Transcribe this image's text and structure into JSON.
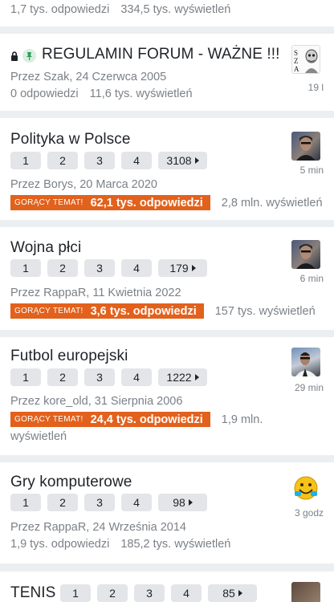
{
  "prev_topic": {
    "replies": "1,7 tys. odpowiedzi",
    "views": "334,5 tys. wyświetleń"
  },
  "topics": [
    {
      "title": "REGULAMIN FORUM - WAŻNE !!!",
      "meta": "Przez Szak, 24 Czerwca 2005",
      "replies": "0 odpowiedzi",
      "views": "11,6 tys. wyświetleń",
      "last": "19 l",
      "locked": true,
      "pinned": true
    },
    {
      "title": "Polityka w Polsce",
      "pages": [
        "1",
        "2",
        "3",
        "4",
        "3108"
      ],
      "meta": "Przez Borys, 20 Marca 2020",
      "hot_label": "GORĄCY TEMAT!",
      "replies": "62,1 tys. odpowiedzi",
      "views": "2,8 mln. wyświetleń",
      "last": "5 min"
    },
    {
      "title": "Wojna płci",
      "pages": [
        "1",
        "2",
        "3",
        "4",
        "179"
      ],
      "meta": "Przez RappaR, 11 Kwietnia 2022",
      "hot_label": "GORĄCY TEMAT!",
      "replies": "3,6 tys. odpowiedzi",
      "views": "157 tys. wyświetleń",
      "last": "6 min"
    },
    {
      "title": "Futbol europejski",
      "pages": [
        "1",
        "2",
        "3",
        "4",
        "1222"
      ],
      "meta": "Przez kore_old, 31 Sierpnia 2006",
      "hot_label": "GORĄCY TEMAT!",
      "replies": "24,4 tys. odpowiedzi",
      "views_1": "1,9 mln.",
      "views_2": "wyświetleń",
      "last": "29 min"
    },
    {
      "title": "Gry komputerowe",
      "pages": [
        "1",
        "2",
        "3",
        "4",
        "98"
      ],
      "meta": "Przez RappaR, 24 Września 2014",
      "replies": "1,9 tys. odpowiedzi",
      "views": "185,2 tys. wyświetleń",
      "last": "3 godz"
    },
    {
      "title": "TENIS",
      "pages": [
        "1",
        "2",
        "3",
        "4",
        "85"
      ]
    }
  ],
  "icons": {
    "lock": "lock-icon",
    "pin": "pin-icon",
    "page_more": "caret-right-icon"
  },
  "colors": {
    "hot_badge": "#e2611c",
    "page_button": "#e3e5e8",
    "muted_text": "#7b8187",
    "background": "#eceff1"
  }
}
